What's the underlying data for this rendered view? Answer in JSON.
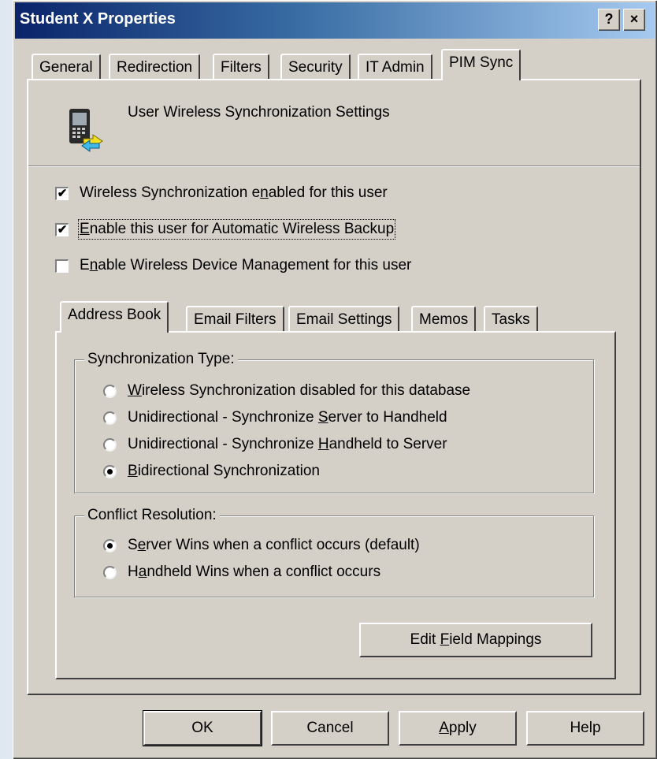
{
  "window": {
    "title": "Student X Properties",
    "help_button": "?",
    "close_button": "×"
  },
  "main_tabs": {
    "general": "General",
    "redirection": "Redirection",
    "filters": "Filters",
    "security": "Security",
    "it_admin": "IT Admin",
    "pim_sync": "PIM Sync",
    "active": "PIM Sync"
  },
  "pim_sync": {
    "header": "User Wireless Synchronization Settings",
    "icon": "handheld-sync-icon",
    "wireless_sync": {
      "pre": "Wireless Synchronization e",
      "key": "n",
      "post": "abled for this user",
      "checked": true
    },
    "auto_backup": {
      "pre": "",
      "key": "E",
      "post": "nable this user for Automatic Wireless Backup",
      "checked": true
    },
    "device_mgmt": {
      "pre": "E",
      "key": "n",
      "post": "able Wireless Device Management for this user",
      "checked": false
    }
  },
  "sub_tabs": {
    "address_book": "Address Book",
    "email_filters": "Email Filters",
    "email_settings": "Email Settings",
    "memos": "Memos",
    "tasks": "Tasks",
    "active": "Address Book"
  },
  "sync_type": {
    "title": "Synchronization Type:",
    "options": [
      {
        "pre": "",
        "key": "W",
        "post": "ireless Synchronization disabled for this database",
        "selected": false
      },
      {
        "pre": "Unidirectional - Synchronize ",
        "key": "S",
        "post": "erver to Handheld",
        "selected": false
      },
      {
        "pre": "Unidirectional - Synchronize ",
        "key": "H",
        "post": "andheld to Server",
        "selected": false
      },
      {
        "pre": "",
        "key": "B",
        "post": "idirectional Synchronization",
        "selected": true
      }
    ]
  },
  "conflict": {
    "title": "Conflict Resolution:",
    "options": [
      {
        "pre": "S",
        "key": "e",
        "post": "rver Wins when a conflict occurs (default)",
        "selected": true
      },
      {
        "pre": "H",
        "key": "a",
        "post": "ndheld Wins when a conflict occurs",
        "selected": false
      }
    ]
  },
  "edit_mappings": {
    "pre": "Edit ",
    "key": "F",
    "post": "ield Mappings"
  },
  "buttons": {
    "ok": "OK",
    "cancel": "Cancel",
    "apply_key": "A",
    "apply_rest": "pply",
    "help": "Help"
  }
}
